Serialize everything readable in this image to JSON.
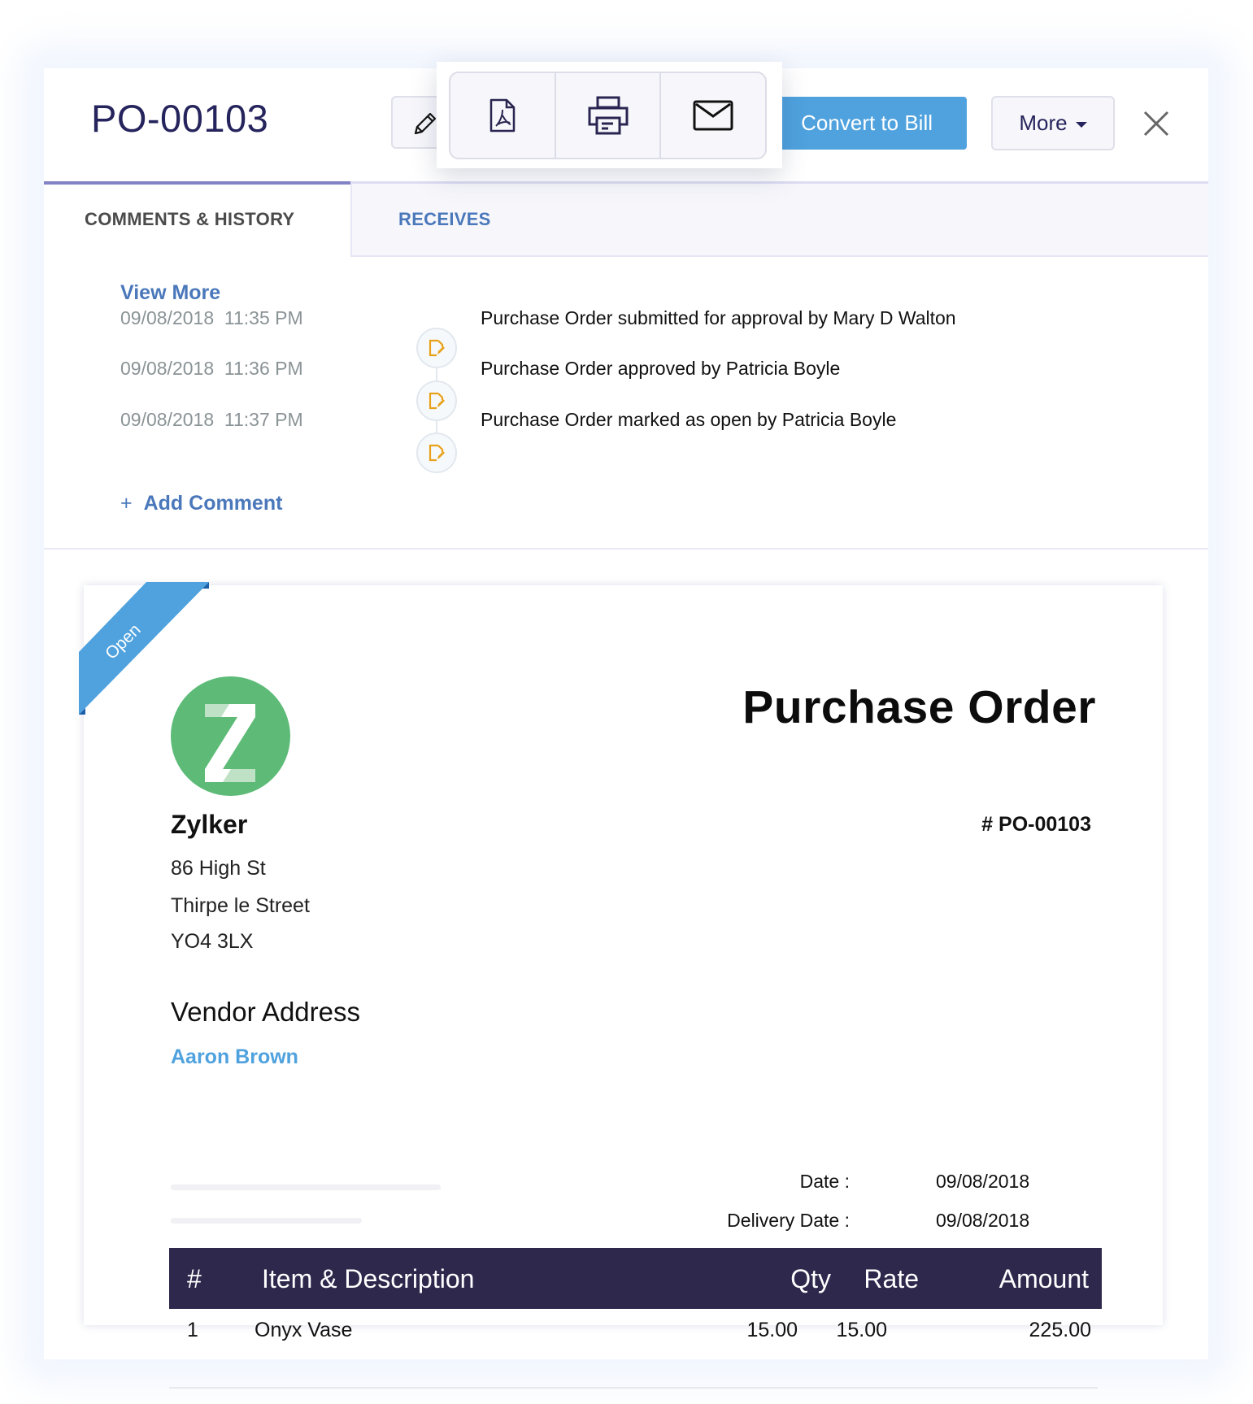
{
  "header": {
    "title": "PO-00103",
    "convert_button": "Convert to Bill",
    "more_button": "More",
    "icons": {
      "edit": "pencil-icon",
      "pdf": "pdf-icon",
      "print": "printer-icon",
      "email": "mail-icon",
      "close": "close-icon",
      "more_caret": "caret-down-icon"
    }
  },
  "tabs": [
    {
      "label": "COMMENTS & HISTORY",
      "active": true
    },
    {
      "label": "RECEIVES",
      "active": false
    }
  ],
  "history": {
    "view_more": "View More",
    "entries": [
      {
        "date": "09/08/2018  11:35 PM",
        "text": "Purchase Order submitted for approval by Mary D Walton"
      },
      {
        "date": "09/08/2018  11:36 PM",
        "text": "Purchase Order approved by Patricia Boyle"
      },
      {
        "date": "09/08/2018  11:37 PM",
        "text": "Purchase Order marked as open by Patricia Boyle"
      }
    ],
    "add_comment_plus": "+",
    "add_comment": "Add Comment"
  },
  "document": {
    "status_ribbon": "Open",
    "logo_letter": "Z",
    "company": {
      "name": "Zylker",
      "address": [
        "86 High St",
        "Thirpe le Street",
        "YO4 3LX"
      ]
    },
    "title": "Purchase Order",
    "number": "# PO-00103",
    "vendor": {
      "heading": "Vendor Address",
      "name": "Aaron Brown"
    },
    "meta": [
      {
        "label": "Date :",
        "value": "09/08/2018"
      },
      {
        "label": "Delivery Date :",
        "value": "09/08/2018"
      }
    ],
    "table": {
      "columns": [
        "#",
        "Item & Description",
        "Qty",
        "Rate",
        "Amount"
      ],
      "rows": [
        {
          "index": "1",
          "item": "Onyx Vase",
          "qty": "15.00",
          "rate": "15.00",
          "amount": "225.00"
        }
      ]
    }
  },
  "colors": {
    "accent_blue": "#4fa2de",
    "link_blue": "#4a78bb",
    "title_navy": "#26245c",
    "table_header": "#2f284d",
    "history_icon": "#e8a21a",
    "logo_green": "#5dbb77"
  }
}
